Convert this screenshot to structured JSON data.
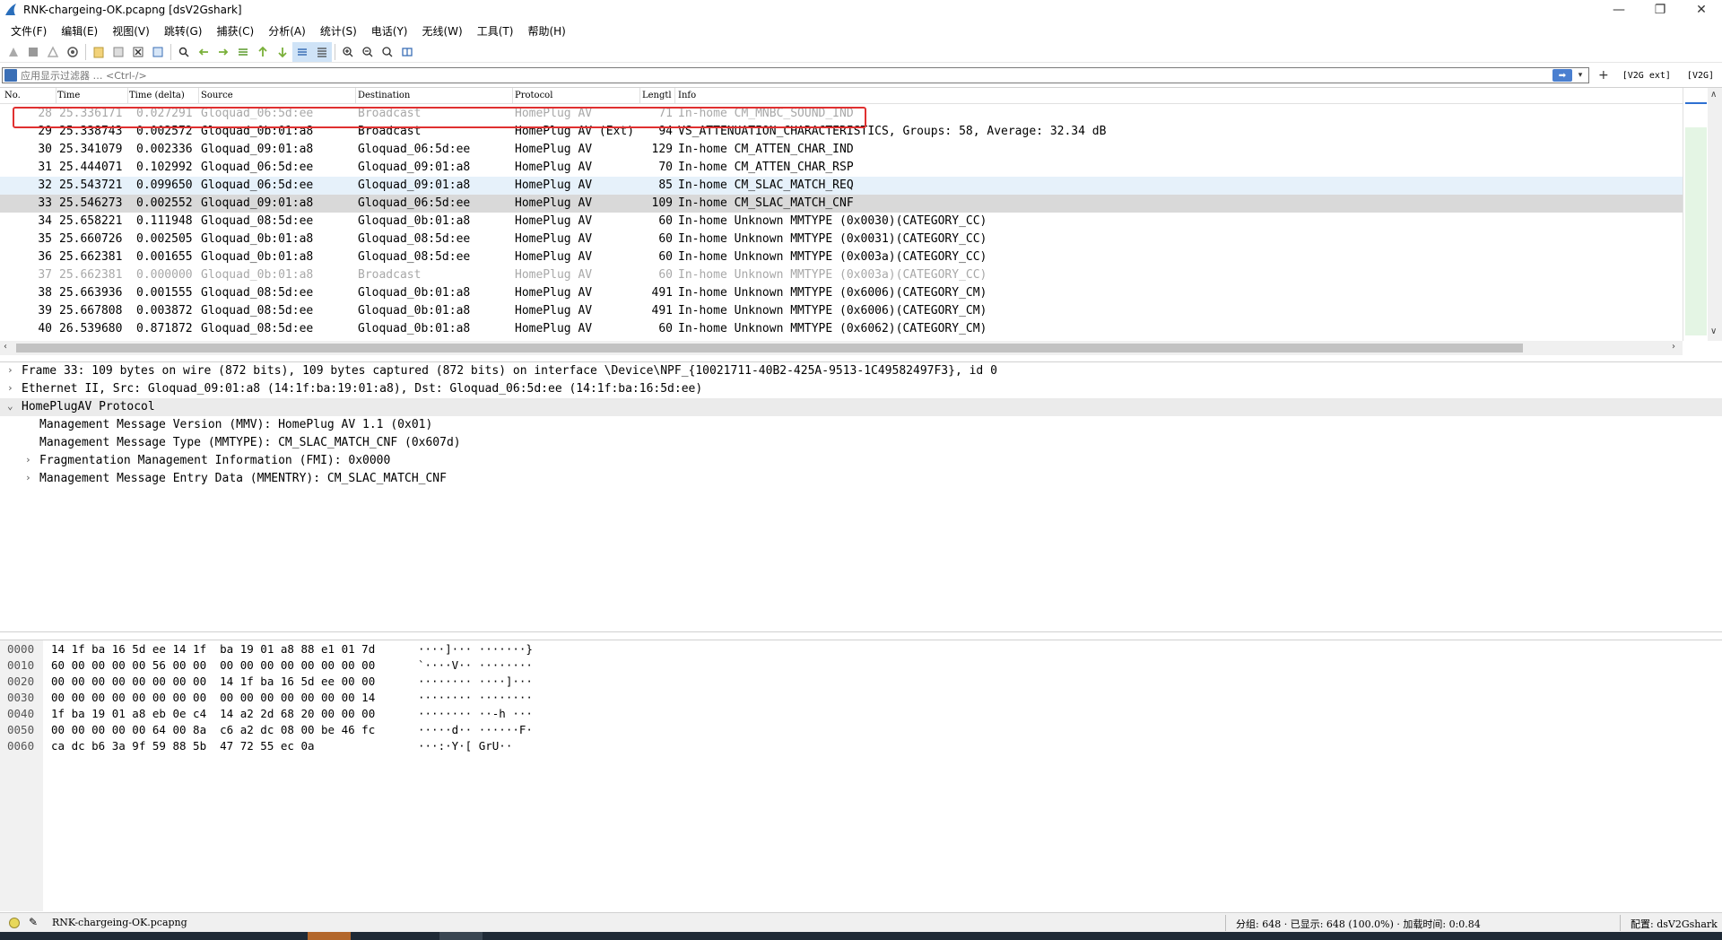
{
  "window": {
    "title": "RNK-chargeing-OK.pcapng [dsV2Gshark]",
    "minimize": "—",
    "maximize": "❐",
    "close": "✕"
  },
  "menu": [
    "文件(F)",
    "编辑(E)",
    "视图(V)",
    "跳转(G)",
    "捕获(C)",
    "分析(A)",
    "统计(S)",
    "电话(Y)",
    "无线(W)",
    "工具(T)",
    "帮助(H)"
  ],
  "filter": {
    "placeholder": "应用显示过滤器 … <Ctrl-/>",
    "apply_icon": "➡",
    "dropdown_icon": "▾",
    "plus": "+",
    "btn1": "[V2G ext]",
    "btn2": "[V2G]"
  },
  "packet_list": {
    "columns": [
      "No.",
      "Time",
      "Time (delta)",
      "Source",
      "Destination",
      "Protocol",
      "Lengtl",
      "Info"
    ],
    "rows": [
      {
        "no": "28",
        "time": "25.336171",
        "delta": "0.027291",
        "src": "Gloquad_06:5d:ee",
        "dst": "Broadcast",
        "proto": "HomePlug AV",
        "len": "71",
        "info": "In-home CM_MNBC_SOUND_IND",
        "style": "grey"
      },
      {
        "no": "29",
        "time": "25.338743",
        "delta": "0.002572",
        "src": "Gloquad_0b:01:a8",
        "dst": "Broadcast",
        "proto": "HomePlug AV (Ext)",
        "len": "94",
        "info": "VS_ATTENUATION_CHARACTERISTICS, Groups: 58, Average: 32.34 dB",
        "style": "normal"
      },
      {
        "no": "30",
        "time": "25.341079",
        "delta": "0.002336",
        "src": "Gloquad_09:01:a8",
        "dst": "Gloquad_06:5d:ee",
        "proto": "HomePlug AV",
        "len": "129",
        "info": "In-home CM_ATTEN_CHAR_IND",
        "style": "normal"
      },
      {
        "no": "31",
        "time": "25.444071",
        "delta": "0.102992",
        "src": "Gloquad_06:5d:ee",
        "dst": "Gloquad_09:01:a8",
        "proto": "HomePlug AV",
        "len": "70",
        "info": "In-home CM_ATTEN_CHAR_RSP",
        "style": "normal"
      },
      {
        "no": "32",
        "time": "25.543721",
        "delta": "0.099650",
        "src": "Gloquad_06:5d:ee",
        "dst": "Gloquad_09:01:a8",
        "proto": "HomePlug AV",
        "len": "85",
        "info": "In-home CM_SLAC_MATCH_REQ",
        "style": "req"
      },
      {
        "no": "33",
        "time": "25.546273",
        "delta": "0.002552",
        "src": "Gloquad_09:01:a8",
        "dst": "Gloquad_06:5d:ee",
        "proto": "HomePlug AV",
        "len": "109",
        "info": "In-home CM_SLAC_MATCH_CNF",
        "style": "selected"
      },
      {
        "no": "34",
        "time": "25.658221",
        "delta": "0.111948",
        "src": "Gloquad_08:5d:ee",
        "dst": "Gloquad_0b:01:a8",
        "proto": "HomePlug AV",
        "len": "60",
        "info": "In-home Unknown MMTYPE (0x0030)(CATEGORY_CC)",
        "style": "normal"
      },
      {
        "no": "35",
        "time": "25.660726",
        "delta": "0.002505",
        "src": "Gloquad_0b:01:a8",
        "dst": "Gloquad_08:5d:ee",
        "proto": "HomePlug AV",
        "len": "60",
        "info": "In-home Unknown MMTYPE (0x0031)(CATEGORY_CC)",
        "style": "normal"
      },
      {
        "no": "36",
        "time": "25.662381",
        "delta": "0.001655",
        "src": "Gloquad_0b:01:a8",
        "dst": "Gloquad_08:5d:ee",
        "proto": "HomePlug AV",
        "len": "60",
        "info": "In-home Unknown MMTYPE (0x003a)(CATEGORY_CC)",
        "style": "normal"
      },
      {
        "no": "37",
        "time": "25.662381",
        "delta": "0.000000",
        "src": "Gloquad_0b:01:a8",
        "dst": "Broadcast",
        "proto": "HomePlug AV",
        "len": "60",
        "info": "In-home Unknown MMTYPE (0x003a)(CATEGORY_CC)",
        "style": "grey"
      },
      {
        "no": "38",
        "time": "25.663936",
        "delta": "0.001555",
        "src": "Gloquad_08:5d:ee",
        "dst": "Gloquad_0b:01:a8",
        "proto": "HomePlug AV",
        "len": "491",
        "info": "In-home Unknown MMTYPE (0x6006)(CATEGORY_CM)",
        "style": "normal"
      },
      {
        "no": "39",
        "time": "25.667808",
        "delta": "0.003872",
        "src": "Gloquad_08:5d:ee",
        "dst": "Gloquad_0b:01:a8",
        "proto": "HomePlug AV",
        "len": "491",
        "info": "In-home Unknown MMTYPE (0x6006)(CATEGORY_CM)",
        "style": "normal"
      },
      {
        "no": "40",
        "time": "26.539680",
        "delta": "0.871872",
        "src": "Gloquad_08:5d:ee",
        "dst": "Gloquad_0b:01:a8",
        "proto": "HomePlug AV",
        "len": "60",
        "info": "In-home Unknown MMTYPE (0x6062)(CATEGORY_CM)",
        "style": "normal"
      }
    ]
  },
  "details": [
    {
      "toggle": "›",
      "text": "Frame 33: 109 bytes on wire (872 bits), 109 bytes captured (872 bits) on interface \\Device\\NPF_{10021711-40B2-425A-9513-1C49582497F3}, id 0",
      "level": 0,
      "highlight": false
    },
    {
      "toggle": "›",
      "text": "Ethernet II, Src: Gloquad_09:01:a8 (14:1f:ba:19:01:a8), Dst: Gloquad_06:5d:ee (14:1f:ba:16:5d:ee)",
      "level": 0,
      "highlight": false
    },
    {
      "toggle": "⌄",
      "text": "HomePlugAV Protocol",
      "level": 0,
      "highlight": true
    },
    {
      "toggle": "",
      "text": "Management Message Version (MMV): HomePlug AV 1.1 (0x01)",
      "level": 1,
      "highlight": false
    },
    {
      "toggle": "",
      "text": "Management Message Type (MMTYPE): CM_SLAC_MATCH_CNF (0x607d)",
      "level": 1,
      "highlight": false
    },
    {
      "toggle": "›",
      "text": "Fragmentation Management Information (FMI): 0x0000",
      "level": 1,
      "highlight": false
    },
    {
      "toggle": "›",
      "text": "Management Message Entry Data (MMENTRY): CM_SLAC_MATCH_CNF",
      "level": 1,
      "highlight": false
    }
  ],
  "bytes": [
    {
      "off": "0000",
      "hex": "14 1f ba 16 5d ee 14 1f  ba 19 01 a8 88 e1 01 7d",
      "ascii": "····]··· ·······}"
    },
    {
      "off": "0010",
      "hex": "60 00 00 00 00 56 00 00  00 00 00 00 00 00 00 00",
      "ascii": "`····V·· ········"
    },
    {
      "off": "0020",
      "hex": "00 00 00 00 00 00 00 00  14 1f ba 16 5d ee 00 00",
      "ascii": "········ ····]···"
    },
    {
      "off": "0030",
      "hex": "00 00 00 00 00 00 00 00  00 00 00 00 00 00 00 14",
      "ascii": "········ ········"
    },
    {
      "off": "0040",
      "hex": "1f ba 19 01 a8 eb 0e c4  14 a2 2d 68 20 00 00 00",
      "ascii": "········ ··-h ···"
    },
    {
      "off": "0050",
      "hex": "00 00 00 00 00 64 00 8a  c6 a2 dc 08 00 be 46 fc",
      "ascii": "·····d·· ······F·"
    },
    {
      "off": "0060",
      "hex": "ca dc b6 3a 9f 59 88 5b  47 72 55 ec 0a",
      "ascii": "···:·Y·[ GrU··"
    }
  ],
  "status": {
    "file": "RNK-chargeing-OK.pcapng",
    "stats": "分组: 648 · 已显示: 648 (100.0%) · 加载时间: 0:0.84",
    "profile": "配置: dsV2Gshark"
  },
  "colors": {
    "selected_row": "#d9d9d9",
    "req_row": "#e6f1fa",
    "highlight_box": "#e03030",
    "grey_text": "#a8a8a8"
  }
}
